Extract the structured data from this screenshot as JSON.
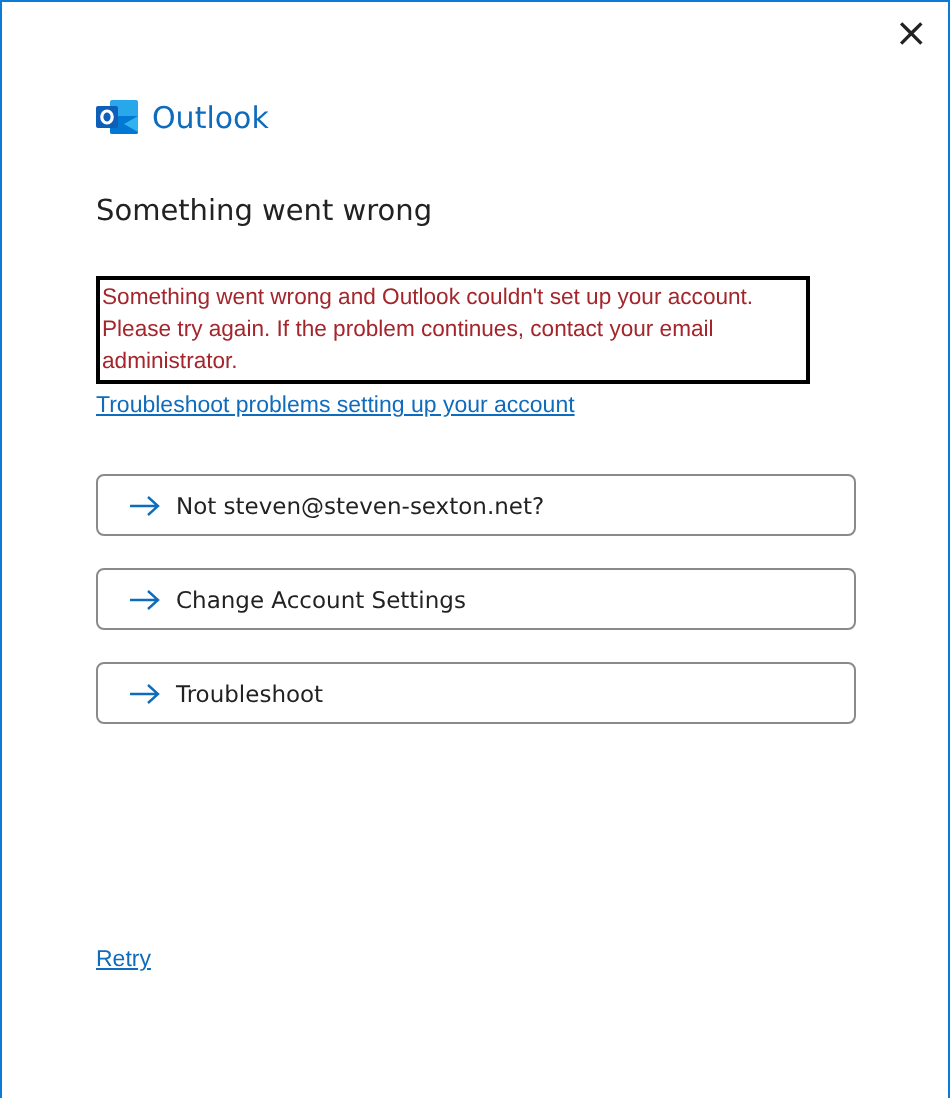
{
  "window": {
    "close": "×"
  },
  "app": {
    "name": "Outlook"
  },
  "heading": "Something went wrong",
  "error": "Something went wrong and Outlook couldn't set up your account. Please try again. If the problem continues, contact your email administrator.",
  "help_link": "Troubleshoot problems setting up your account",
  "actions": [
    {
      "label": "Not steven@steven-sexton.net?"
    },
    {
      "label": "Change Account Settings"
    },
    {
      "label": "Troubleshoot"
    }
  ],
  "retry_link": "Retry"
}
